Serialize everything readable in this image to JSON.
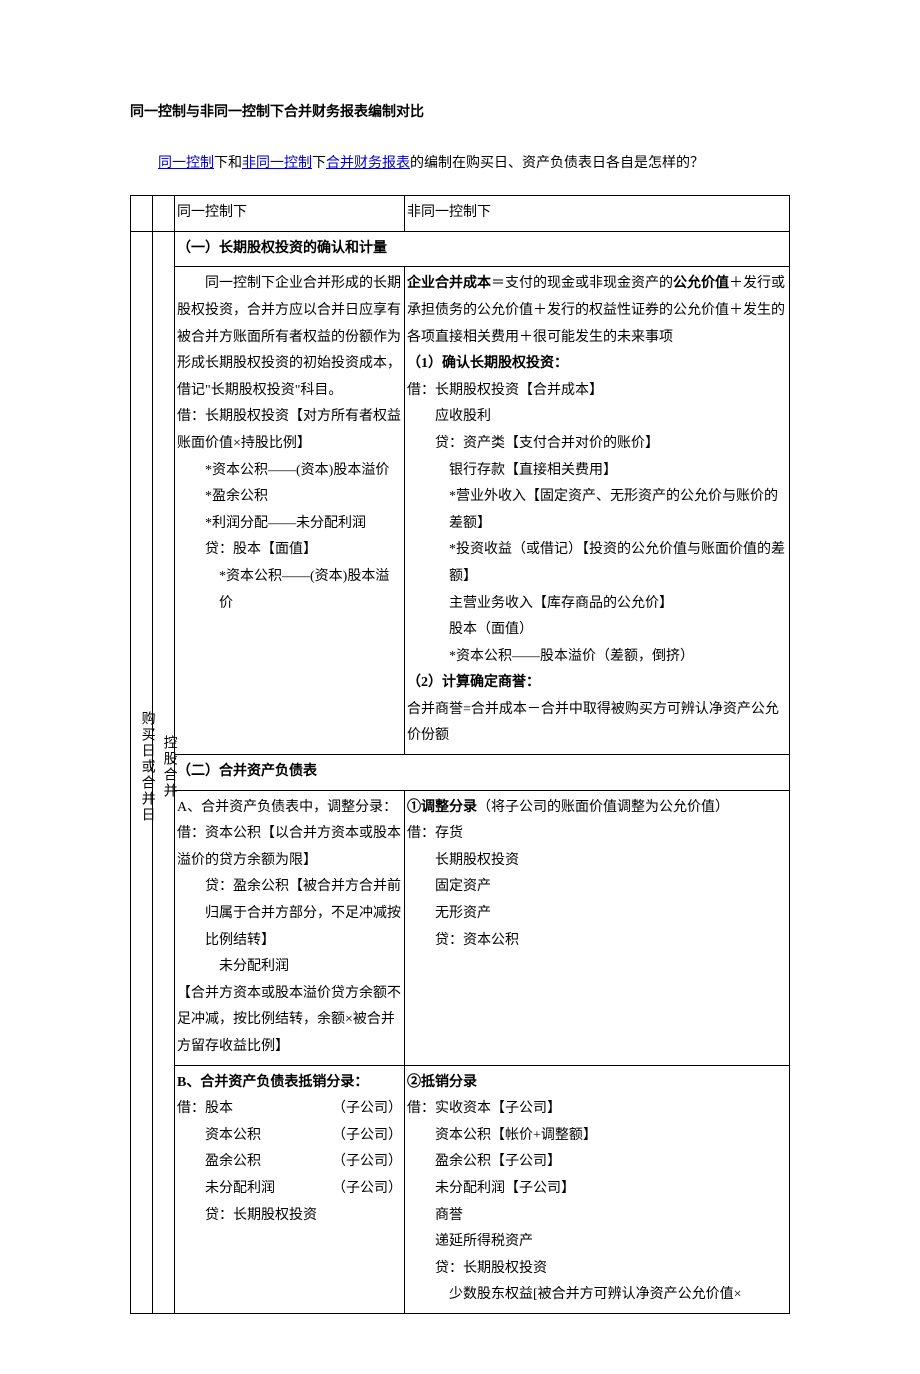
{
  "title": "同一控制与非同一控制下合并财务报表编制对比",
  "intro": {
    "p1a": "同一控制",
    "p1b": "下和",
    "p1c": "非同一控制",
    "p1d": "下",
    "p1e": "合并财务报表",
    "p1f": "的编制在购买日、资产负债表日各自是怎样的？"
  },
  "h": {
    "c1": "同一控制下",
    "c2": "非同一控制下"
  },
  "rowlabel1": "购买日或合并日",
  "rowlabel2": "控股合并",
  "s1": {
    "header": "（一）长期股权投资的确认和计量",
    "left": {
      "l1": "　　同一控制下企业合并形成的长期股权投资，合并方应以合并日应享有被合并方账面所有者权益的份额作为形成长期股权投资的初始投资成本，借记\"长期股权投资\"科目。",
      "l2": "借：长期股权投资【对方所有者权益账面价值×持股比例】",
      "l3": "*资本公积——(资本)股本溢价",
      "l4": "*盈余公积",
      "l5": "*利润分配——未分配利润",
      "l6": "贷：股本【面值】",
      "l7": "*资本公积——(资本)股本溢价"
    },
    "right": {
      "r1a": "企业合并成本",
      "r1b": "＝支付的现金或非现金资产的",
      "r1c": "公允价值",
      "r1d": "＋发行或承担债务的公允价值＋发行的权益性证券的公允价值＋发生的各项直接相关费用＋很可能发生的未来事项",
      "r2": "（1）确认长期股权投资：",
      "r3": "借：长期股权投资【合并成本】",
      "r4": "应收股利",
      "r5": "贷：资产类【支付合并对价的账价】",
      "r6": "银行存款【直接相关费用】",
      "r7": "*营业外收入【固定资产、无形资产的公允价与账价的差额】",
      "r8": "*投资收益（或借记）【投资的公允价值与账面价值的差额】",
      "r9": "主营业务收入【库存商品的公允价】",
      "r10": "股本（面值）",
      "r11": "*资本公积——股本溢价（差额，倒挤）",
      "r12": "（2）计算确定商誉：",
      "r13": "合并商誉=合并成本－合并中取得被购买方可辨认净资产公允价份额"
    }
  },
  "s2": {
    "header": "（二）合并资产负债表",
    "leftA": {
      "l1": "A、合并资产负债表中，调整分录：",
      "l2": "借：资本公积【以合并方资本或股本溢价的贷方余额为限】",
      "l3": "贷：盈余公积【被合并方合并前归属于合并方部分，不足冲减按比例结转】",
      "l4": "未分配利润",
      "l5": "【合并方资本或股本溢价贷方余额不足冲减，按比例结转，余额×被合并方留存收益比例】"
    },
    "rightA": {
      "r1a": "①调整分录",
      "r1b": "（将子公司的账面价值调整为公允价值）",
      "r2": "借：存货",
      "r3": "长期股权投资",
      "r4": "固定资产",
      "r5": "无形资产",
      "r6": "贷：资本公积"
    },
    "leftB": {
      "l1": "B、合并资产负债表抵销分录：",
      "l2a": "借：股本",
      "l2b": "（子公司）",
      "l3a": "资本公积",
      "l3b": "（子公司）",
      "l4a": "盈余公积",
      "l4b": "（子公司）",
      "l5a": "未分配利润",
      "l5b": "（子公司）",
      "l6": "贷：长期股权投资"
    },
    "rightB": {
      "r1": "②抵销分录",
      "r2": "借：实收资本【子公司】",
      "r3": "资本公积【帐价+调整额】",
      "r4": "盈余公积【子公司】",
      "r5": "未分配利润【子公司】",
      "r6": "商誉",
      "r7": "递延所得税资产",
      "r8": "贷：长期股权投资",
      "r9": "少数股东权益[被合并方可辨认净资产公允价值×"
    }
  }
}
